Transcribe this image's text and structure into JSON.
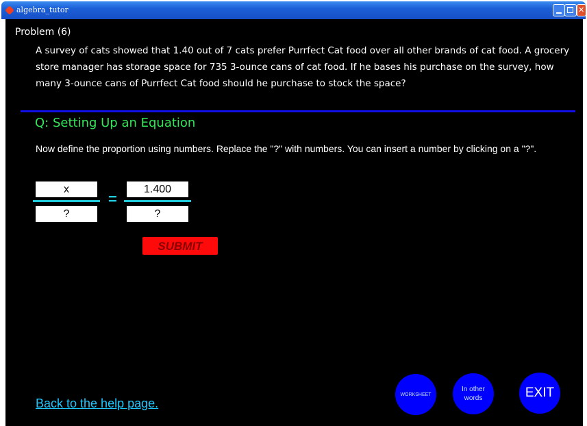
{
  "window": {
    "title": "algebra_tutor"
  },
  "problem": {
    "title": "Problem (6)",
    "text": "A survey of cats showed that 1.40 out of 7 cats prefer Purrfect Cat food over all other brands of cat food. A grocery store manager has storage space for 735 3-ounce cans of cat food. If he bases his purchase on the survey, how many 3-ounce cans of Purrfect Cat food should he purchase to stock the space?"
  },
  "question": {
    "title": "Q: Setting Up an Equation",
    "instructions": "Now define the proportion using numbers. Replace the \"?\" with numbers. You can insert a number by clicking on a \"?\"."
  },
  "equation": {
    "left_numerator": "x",
    "left_denominator": "?",
    "equals": "=",
    "right_numerator": "1.400",
    "right_denominator": "?"
  },
  "buttons": {
    "submit": "SUBMIT",
    "worksheet": "WORKSHEET",
    "other_words": "In other words",
    "exit": "EXIT"
  },
  "links": {
    "back": "Back to the help page."
  },
  "colors": {
    "background": "#000000",
    "accent_green": "#33e65a",
    "divider_blue": "#1010e6",
    "fraction_cyan": "#21c8d8",
    "submit_red": "#ff0a0a",
    "circle_blue": "#0000ff",
    "link_blue": "#1ec8ff"
  }
}
